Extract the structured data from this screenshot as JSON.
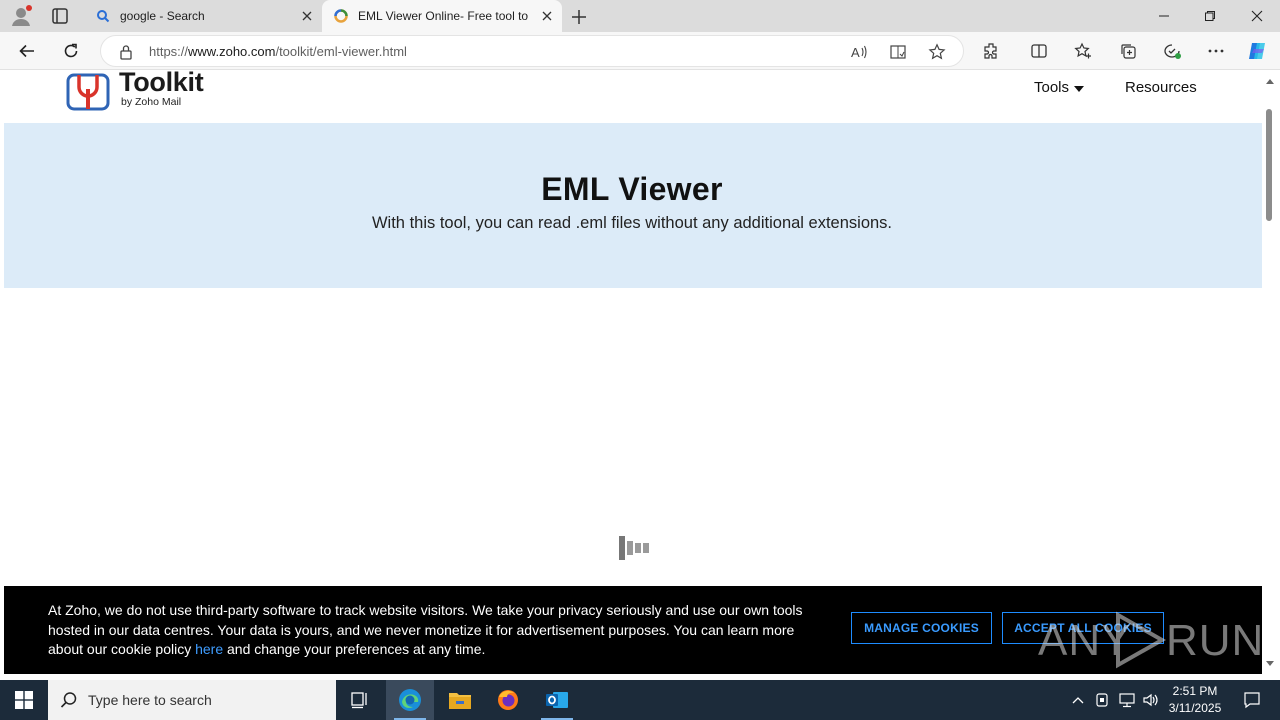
{
  "browser": {
    "tabs": [
      {
        "title": "google - Search",
        "favicon": "search-icon",
        "active": false
      },
      {
        "title": "EML Viewer Online- Free tool to r",
        "favicon": "zoho-favicon",
        "active": true
      }
    ],
    "url_prefix": "https://",
    "url_host": "www.zoho.com",
    "url_path": "/toolkit/eml-viewer.html"
  },
  "site": {
    "logo_title": "Toolkit",
    "logo_subtitle": "by Zoho Mail",
    "nav": {
      "tools": "Tools",
      "resources": "Resources"
    },
    "hero_title": "EML Viewer",
    "hero_subtitle": "With this tool, you can read .eml files without any additional extensions."
  },
  "cookie_banner": {
    "text_before_link": "At Zoho, we do not use third-party software to track website visitors. We take your privacy seriously and use our own tools hosted in our data centres. Your data is yours, and we never monetize it for advertisement purposes. You can learn more about our cookie policy ",
    "link_text": "here",
    "text_after_link": " and change your preferences at any time.",
    "manage_label": "MANAGE COOKIES",
    "accept_label": "ACCEPT ALL COOKIES"
  },
  "watermark": {
    "left": "ANY",
    "right": "RUN"
  },
  "taskbar": {
    "search_placeholder": "Type here to search",
    "time": "2:51 PM",
    "date": "3/11/2025"
  },
  "colors": {
    "hero_bg": "#dcebf8",
    "cookie_bg": "#000000",
    "cookie_accent": "#1e8cff",
    "taskbar_bg": "#1c2b3a"
  }
}
